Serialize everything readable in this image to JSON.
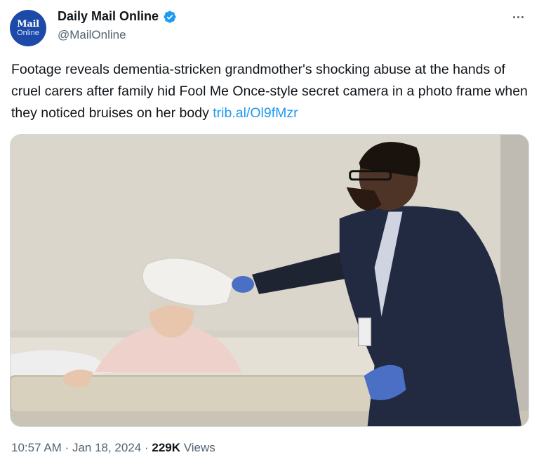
{
  "account": {
    "avatar_line1": "Mail",
    "avatar_line2": "Online",
    "display_name": "Daily Mail Online",
    "handle": "@MailOnline",
    "verified_color": "#1d9bf0"
  },
  "menu": {
    "icon": "more-horizontal-icon"
  },
  "tweet": {
    "text": "Footage reveals dementia-stricken grandmother's shocking abuse at the hands of cruel carers after family hid Fool Me Once-style secret camera in a photo frame when they noticed bruises on her body ",
    "link": "trib.al/Ol9fMzr",
    "link_color": "#1d9bf0"
  },
  "media": {
    "kind": "photo"
  },
  "meta": {
    "time": "10:57 AM",
    "separator": " · ",
    "date": "Jan 18, 2024",
    "views_count": "229K",
    "views_label": " Views"
  }
}
